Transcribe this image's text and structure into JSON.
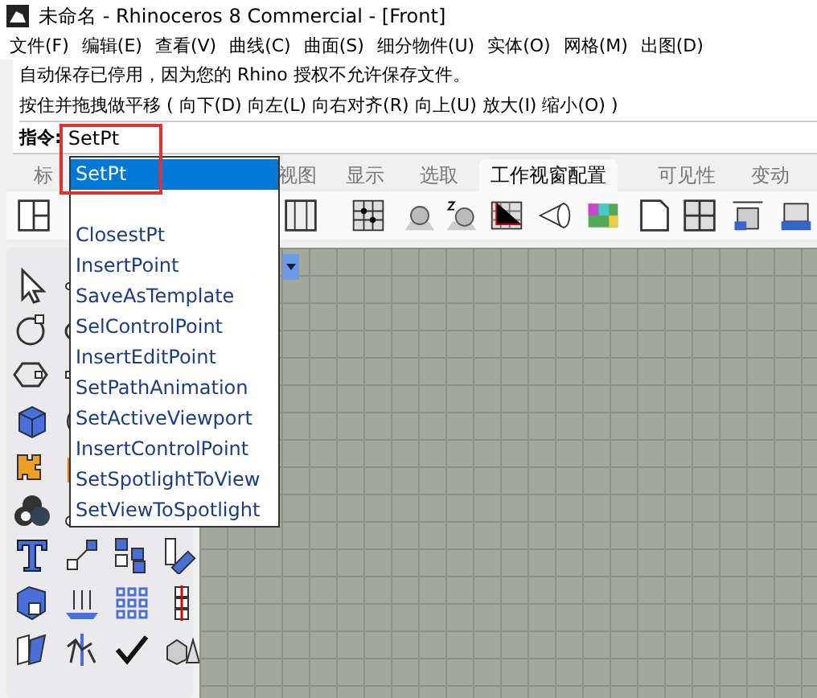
{
  "window": {
    "title": "未命名 - Rhinoceros 8 Commercial - [Front]"
  },
  "menu": [
    "文件(F)",
    "编辑(E)",
    "查看(V)",
    "曲线(C)",
    "曲面(S)",
    "细分物件(U)",
    "实体(O)",
    "网格(M)",
    "出图(D)"
  ],
  "command_history": [
    "自动保存已停用，因为您的 Rhino 授权不允许保存文件。",
    "按住并拖拽做平移 ( 向下(D)  向左(L)  向右对齐(R)  向上(U)  放大(I)  缩小(O) )"
  ],
  "command_prompt": {
    "label": "指令:",
    "value": "SetPt"
  },
  "tabs": [
    {
      "label": "标",
      "selected": false
    },
    {
      "label": "视图",
      "selected": false
    },
    {
      "label": "显示",
      "selected": false
    },
    {
      "label": "选取",
      "selected": false
    },
    {
      "label": "工作视窗配置",
      "selected": true
    },
    {
      "label": "可见性",
      "selected": false
    },
    {
      "label": "变动",
      "selected": false
    }
  ],
  "autocomplete": {
    "match": [
      {
        "label": "SetPt",
        "selected": true
      }
    ],
    "suggestions": [
      {
        "label": "ClosestPt",
        "selected": false
      },
      {
        "label": "InsertPoint",
        "selected": false
      },
      {
        "label": "SaveAsTemplate",
        "selected": false
      },
      {
        "label": "SelControlPoint",
        "selected": false
      },
      {
        "label": "InsertEditPoint",
        "selected": false
      },
      {
        "label": "SetPathAnimation",
        "selected": false
      },
      {
        "label": "SetActiveViewport",
        "selected": false
      },
      {
        "label": "InsertControlPoint",
        "selected": false
      },
      {
        "label": "SetSpotlightToView",
        "selected": false
      },
      {
        "label": "SetViewToSpotlight",
        "selected": false
      }
    ]
  }
}
